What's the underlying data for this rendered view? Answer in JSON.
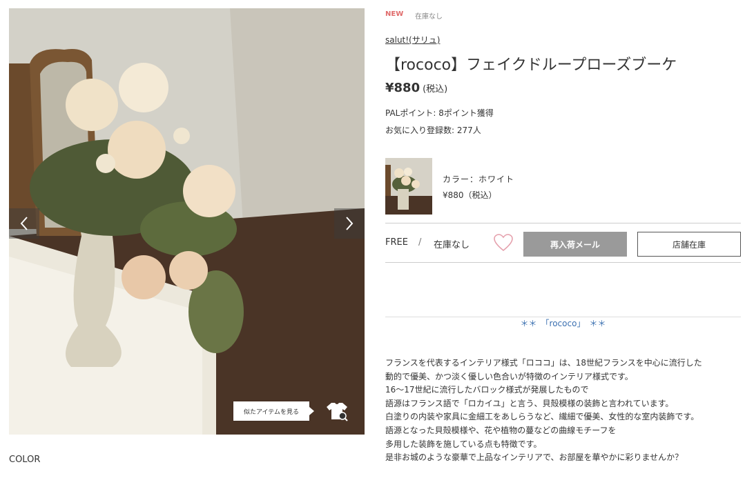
{
  "product": {
    "badge_new": "NEW",
    "badge_stock": "在庫なし",
    "brand": "salut!(サリュ)",
    "title": "【rococo】フェイクドループローズブーケ",
    "price": "¥880",
    "price_tax": "(税込)",
    "pal_points": "PALポイント: 8ポイント獲得",
    "favorite_count": "お気に入り登録数: 277人"
  },
  "gallery": {
    "similar_items_label": "似たアイテムを見る",
    "color_section_label": "COLOR"
  },
  "variant": {
    "color_name": "カラー：ホワイト",
    "price": "¥880（税込）"
  },
  "size_row": {
    "size": "FREE",
    "separator": "/",
    "stock": "在庫なし",
    "restock_button": "再入荷メール",
    "store_stock_button": "店舗在庫"
  },
  "description": {
    "heading": "＊＊　「rococo」　＊＊",
    "lines": [
      "フランスを代表するインテリア様式「ロココ」は、18世紀フランスを中心に流行した",
      "動的で優美、かつ淡く優しい色合いが特徴のインテリア様式です。",
      "16～17世紀に流行したバロック様式が発展したもので",
      "語源はフランス語で「ロカイユ」と言う、貝殻模様の装飾と言われています。",
      "白塗りの内装や家具に金細工をあしらうなど、繊細で優美、女性的な室内装飾です。",
      "語源となった貝殻模様や、花や植物の蔓などの曲線モチーフを",
      "多用した装飾を施している点も特徴です。",
      "是非お城のような豪華で上品なインテリアで、お部屋を華やかに彩りませんか？"
    ]
  },
  "colors": {
    "accent_link": "#3a6fb0",
    "new_badge": "#e06b6b",
    "restock_bg": "#9a9a9a",
    "heart": "#e5a0ac"
  },
  "icons": {
    "prev": "chevron-left-icon",
    "next": "chevron-right-icon",
    "similar": "tshirt-search-icon",
    "favorite": "heart-icon"
  }
}
